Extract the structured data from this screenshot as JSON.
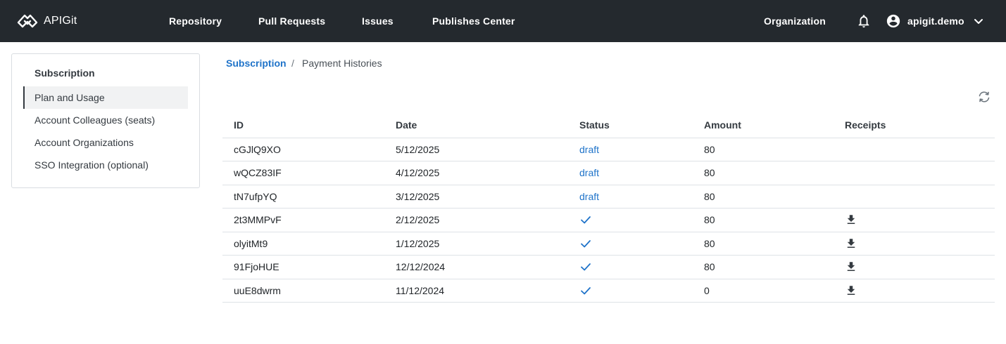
{
  "header": {
    "brand": "APIGit",
    "nav": {
      "repository": "Repository",
      "pull_requests": "Pull Requests",
      "issues": "Issues",
      "publishes_center": "Publishes Center",
      "organization": "Organization"
    },
    "user": "apigit.demo"
  },
  "sidebar": {
    "title": "Subscription",
    "items": [
      {
        "label": "Plan and Usage"
      },
      {
        "label": "Account Colleagues (seats)"
      },
      {
        "label": "Account Organizations"
      },
      {
        "label": "SSO Integration (optional)"
      }
    ]
  },
  "breadcrumb": {
    "parent": "Subscription",
    "separator": "/",
    "current": "Payment Histories"
  },
  "table": {
    "headers": {
      "id": "ID",
      "date": "Date",
      "status": "Status",
      "amount": "Amount",
      "receipts": "Receipts"
    },
    "rows": [
      {
        "id": "cGJlQ9XO",
        "date": "5/12/2025",
        "status": "draft",
        "amount": "80",
        "receipt": false
      },
      {
        "id": "wQCZ83IF",
        "date": "4/12/2025",
        "status": "draft",
        "amount": "80",
        "receipt": false
      },
      {
        "id": "tN7ufpYQ",
        "date": "3/12/2025",
        "status": "draft",
        "amount": "80",
        "receipt": false
      },
      {
        "id": "2t3MMPvF",
        "date": "2/12/2025",
        "status": "paid",
        "amount": "80",
        "receipt": true
      },
      {
        "id": "olyitMt9",
        "date": "1/12/2025",
        "status": "paid",
        "amount": "80",
        "receipt": true
      },
      {
        "id": "91FjoHUE",
        "date": "12/12/2024",
        "status": "paid",
        "amount": "80",
        "receipt": true
      },
      {
        "id": "uuE8dwrm",
        "date": "11/12/2024",
        "status": "paid",
        "amount": "0",
        "receipt": true
      }
    ]
  },
  "icons": {
    "brand": "apigit-logo-icon",
    "bell": "bell-icon",
    "user": "account-circle-icon",
    "chevron": "chevron-down-icon",
    "refresh": "refresh-icon",
    "paid": "check-icon",
    "receipt": "download-icon"
  },
  "colors": {
    "header_bg": "#24292e",
    "link": "#1f73c9",
    "border": "#dee2e6"
  }
}
